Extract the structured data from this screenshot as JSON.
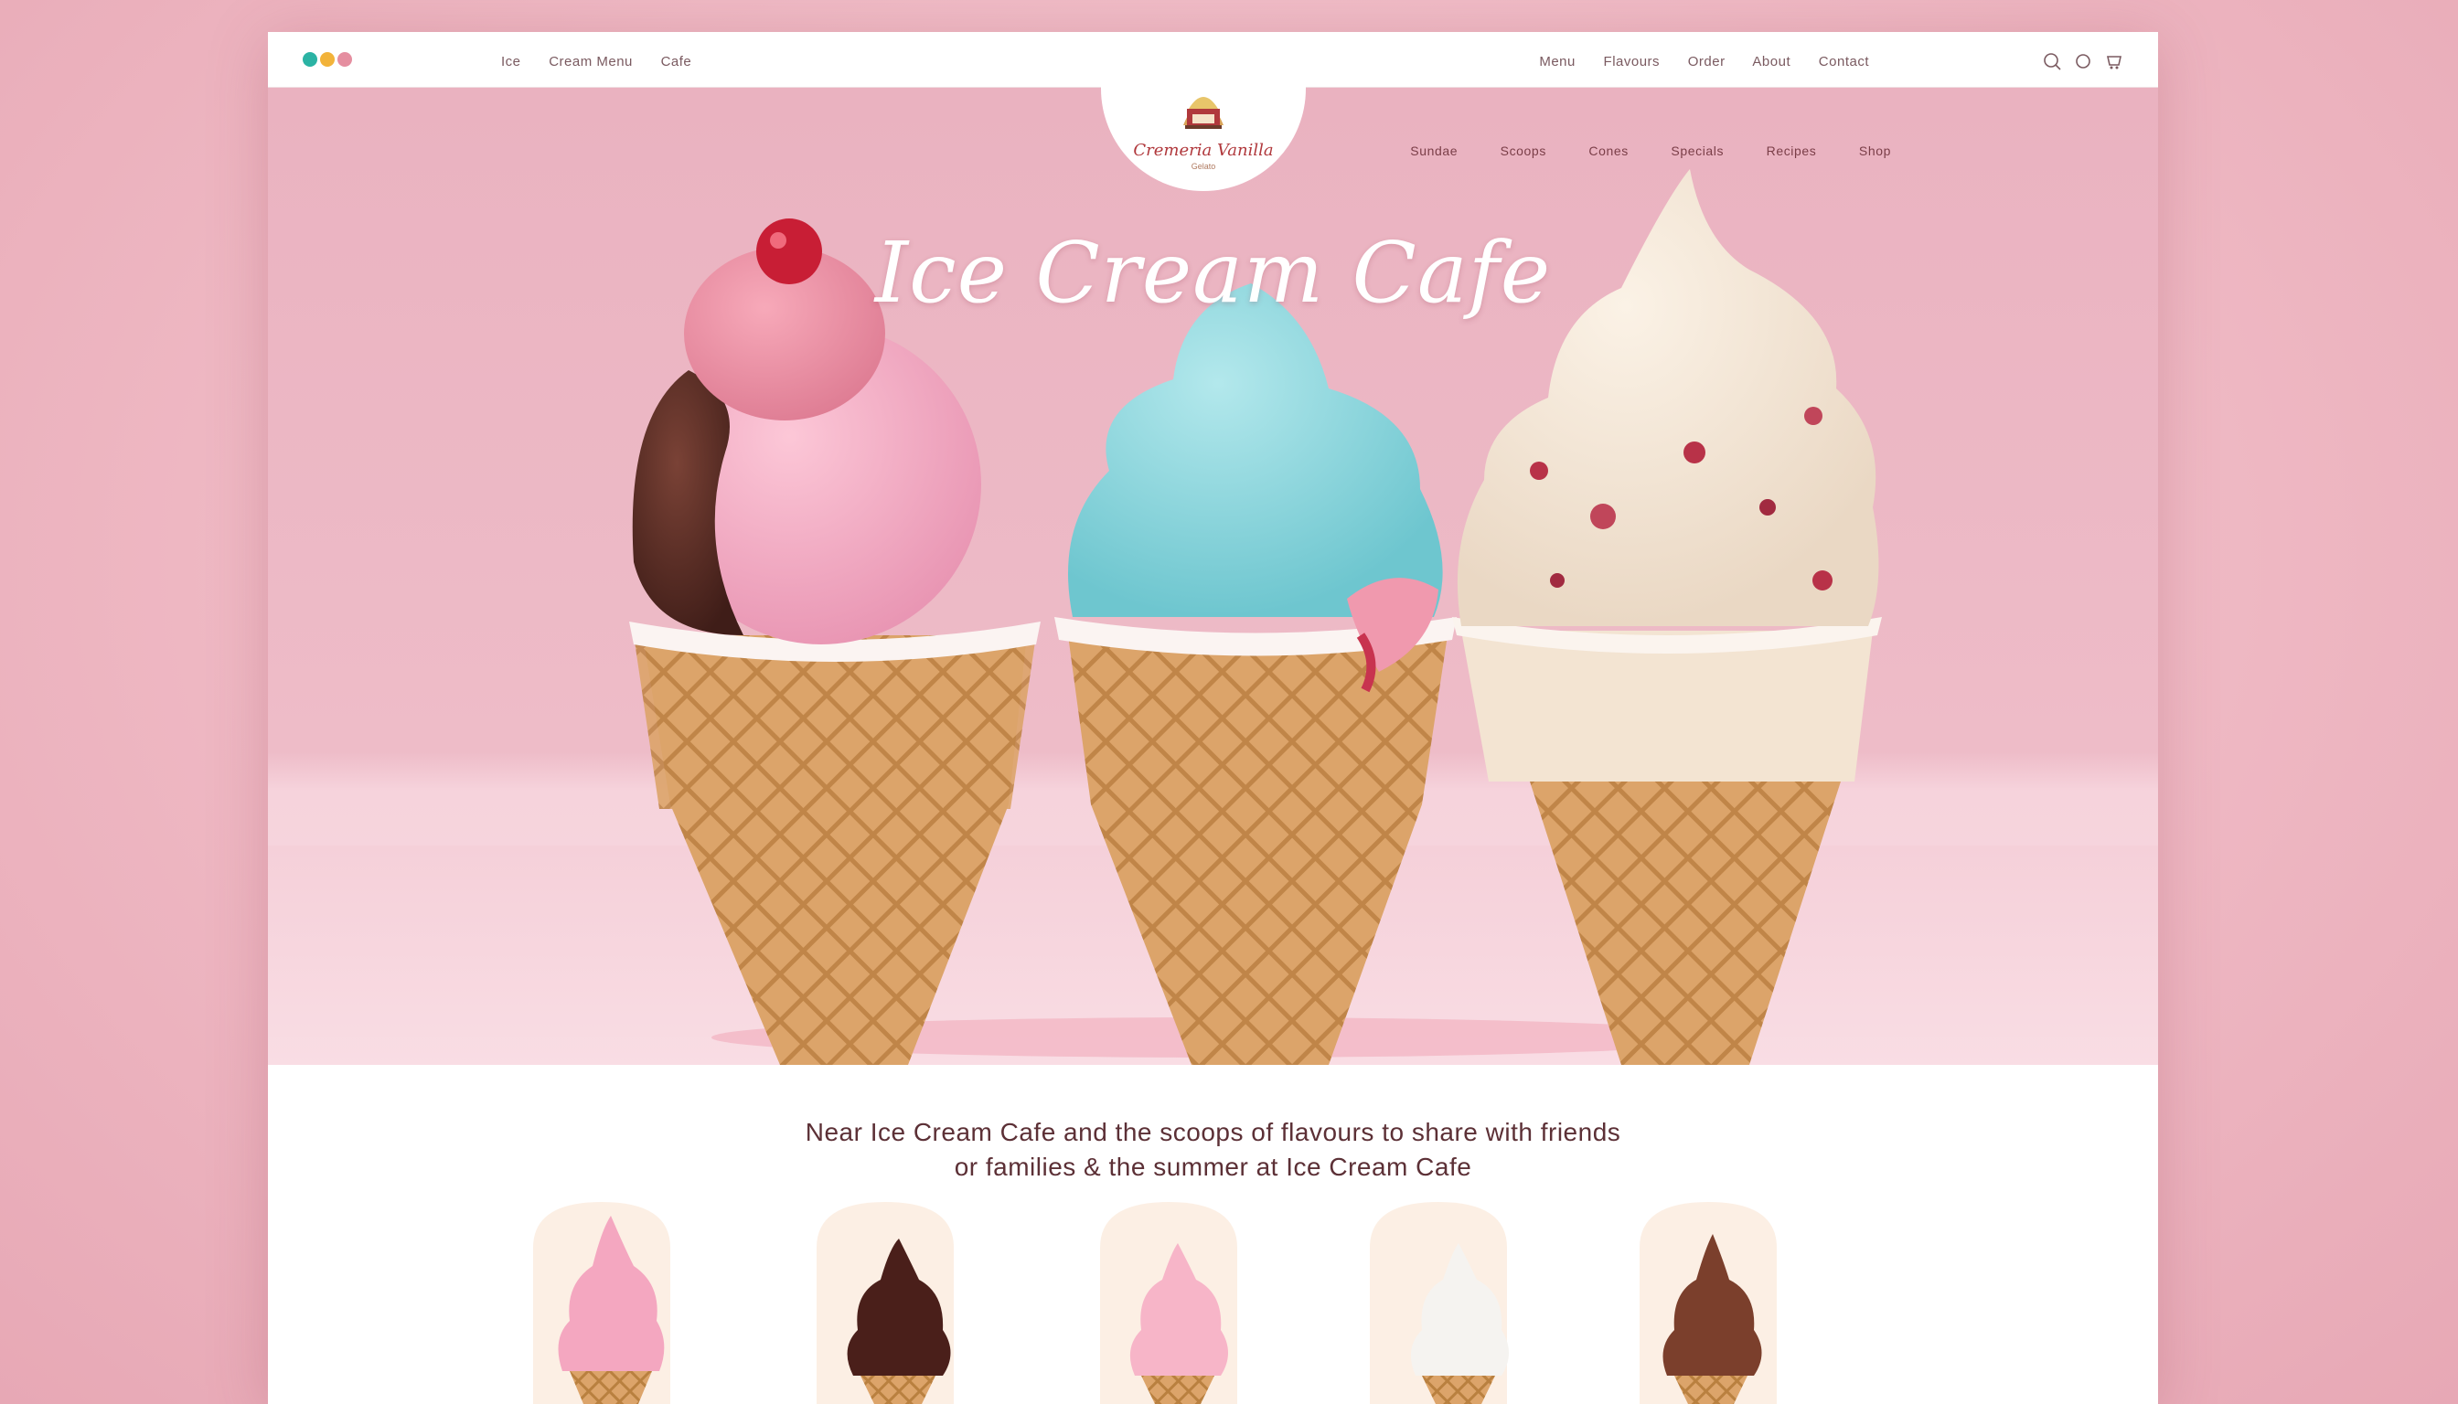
{
  "topbar": {
    "left_nav": [
      "Ice",
      "Cream Menu",
      "Cafe"
    ],
    "right_nav": [
      "Menu",
      "Flavours",
      "Order",
      "About",
      "Contact"
    ],
    "icons": [
      "search-icon",
      "heart-icon",
      "cart-icon"
    ]
  },
  "logo": {
    "name": "Cremeria Vanilla",
    "sub": "Gelato"
  },
  "hero_nav": [
    "Sundae",
    "Scoops",
    "Cones",
    "Specials",
    "Recipes",
    "Shop"
  ],
  "hero": {
    "title": "Ice Cream Cafe"
  },
  "tagline": {
    "line1": "Near Ice Cream Cafe and the scoops of flavours to share with friends",
    "line2": "or families & the summer at Ice Cream Cafe"
  },
  "colors": {
    "hero_pink": "#eab2c0",
    "accent_red": "#b0383c",
    "text_brown": "#5c3036"
  }
}
